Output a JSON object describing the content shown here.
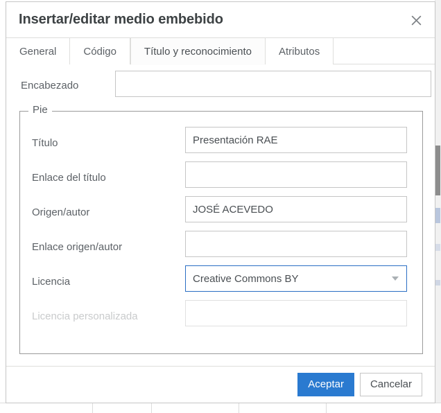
{
  "backdrop": {
    "scrollbar_name": "page-scrollbar"
  },
  "dialog": {
    "title": "Insertar/editar medio embebido",
    "close_icon": "close-icon",
    "close_label": "×"
  },
  "tabs": [
    {
      "label": "General",
      "active": false
    },
    {
      "label": "Código",
      "active": false
    },
    {
      "label": "Título y reconocimiento",
      "active": true
    },
    {
      "label": "Atributos",
      "active": false
    }
  ],
  "form": {
    "heading": {
      "label": "Encabezado",
      "value": "",
      "placeholder": ""
    },
    "fieldset": {
      "legend": "Pie",
      "rows": [
        {
          "label": "Título",
          "value": "Presentación RAE",
          "placeholder": "",
          "type": "text",
          "disabled": false,
          "focused": false
        },
        {
          "label": "Enlace del título",
          "value": "",
          "placeholder": "",
          "type": "text",
          "disabled": false,
          "focused": false
        },
        {
          "label": "Origen/autor",
          "value": "JOSÉ ACEVEDO",
          "placeholder": "",
          "type": "text",
          "disabled": false,
          "focused": false
        },
        {
          "label": "Enlace origen/autor",
          "value": "",
          "placeholder": "",
          "type": "text",
          "disabled": false,
          "focused": false
        },
        {
          "label": "Licencia",
          "value": "Creative Commons BY",
          "placeholder": "",
          "type": "select",
          "disabled": false,
          "focused": true
        },
        {
          "label": "Licencia personalizada",
          "value": "",
          "placeholder": "",
          "type": "text",
          "disabled": true,
          "focused": false
        }
      ]
    }
  },
  "footer": {
    "accept_label": "Aceptar",
    "cancel_label": "Cancelar"
  },
  "colors": {
    "accent": "#2a7ad0",
    "focus_border": "#2a6ec4",
    "text": "#5c6166",
    "title": "#3d4244",
    "border": "#c5c5c5",
    "disabled_text": "#c9cbcc"
  }
}
